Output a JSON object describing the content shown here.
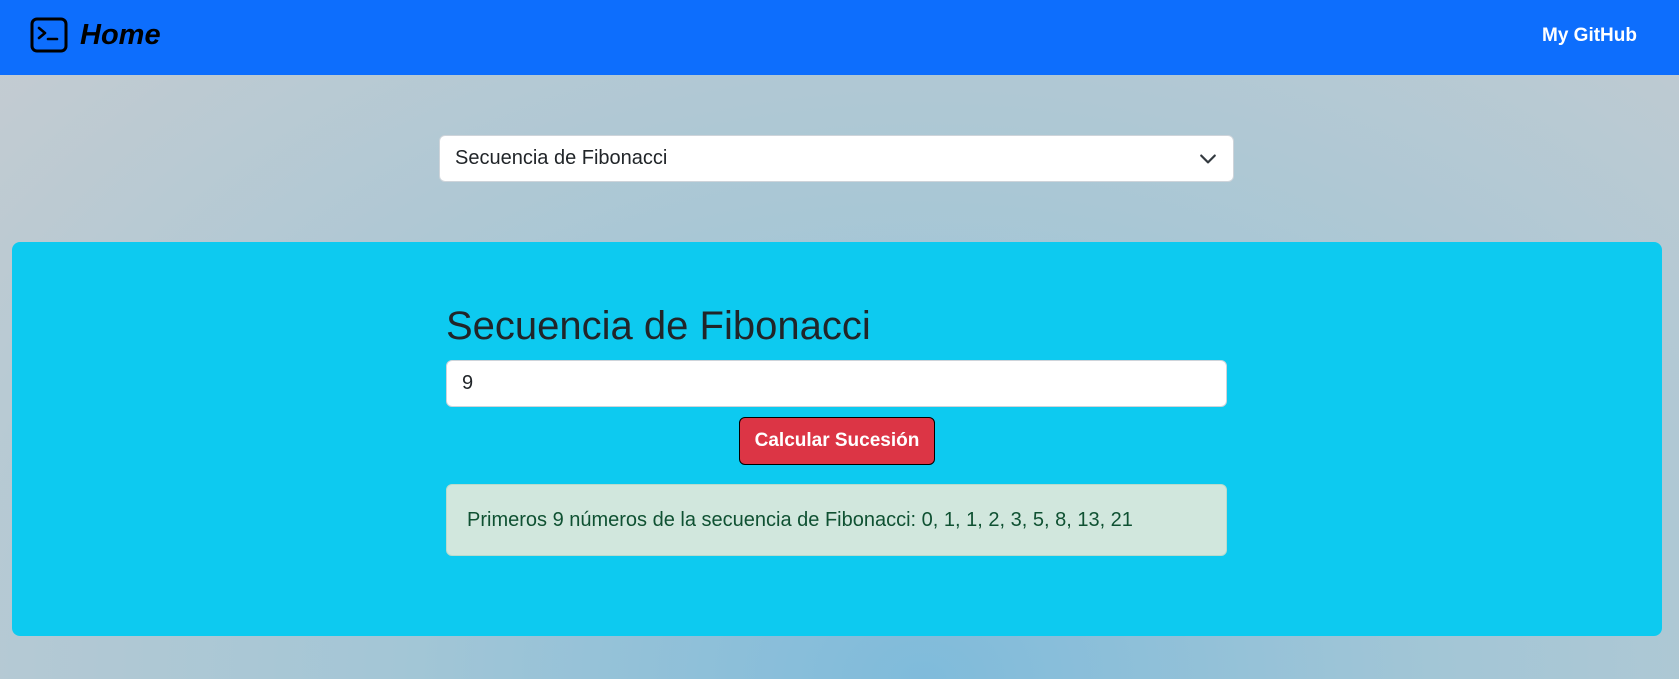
{
  "navbar": {
    "brand_label": "Home",
    "brand_icon": "terminal-icon",
    "github_link": "My GitHub",
    "color": "#0d6efd"
  },
  "selector": {
    "selected": "Secuencia de Fibonacci",
    "icon": "chevron-down-icon"
  },
  "card": {
    "title": "Secuencia de Fibonacci",
    "input_value": "9",
    "button_label": "Calcular Sucesión",
    "result_text": "Primeros 9 números de la secuencia de Fibonacci: 0, 1, 1, 2, 3, 5, 8, 13, 21",
    "background": "#0dcaf0",
    "button_color": "#dc3545",
    "result_background": "#d1e7dd"
  }
}
